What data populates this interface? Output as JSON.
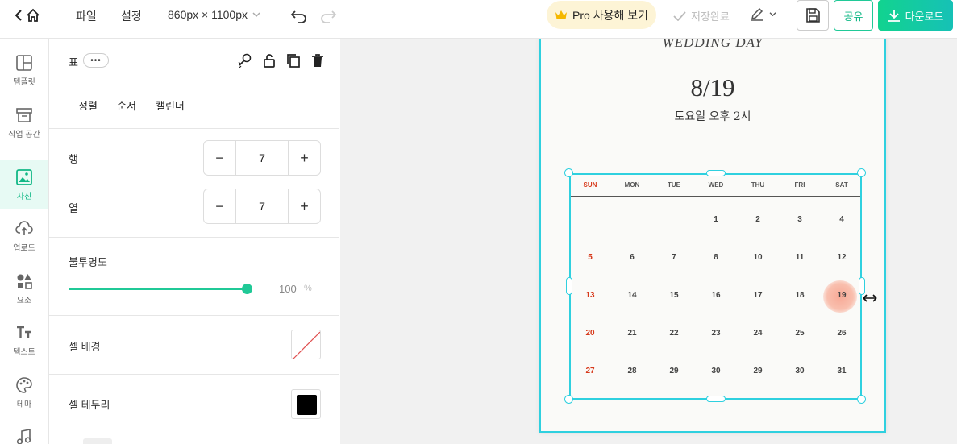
{
  "topbar": {
    "menu_file": "파일",
    "menu_settings": "설정",
    "canvas_size": "860px × 1100px",
    "pro_label": "Pro 사용해 보기",
    "save_status": "저장완료",
    "share_label": "공유",
    "download_label": "다운로드"
  },
  "rail": {
    "items": [
      {
        "label": "템플릿",
        "icon": "template-icon"
      },
      {
        "label": "작업 공간",
        "icon": "archive-icon"
      },
      {
        "label": "사진",
        "icon": "image-icon",
        "active": true
      },
      {
        "label": "업로드",
        "icon": "upload-icon"
      },
      {
        "label": "요소",
        "icon": "shapes-icon"
      },
      {
        "label": "텍스트",
        "icon": "text-icon"
      },
      {
        "label": "테마",
        "icon": "palette-icon"
      }
    ]
  },
  "panel": {
    "title": "표",
    "more": "•••",
    "tabs": [
      "정렬",
      "순서",
      "캘린더"
    ],
    "rows_label": "행",
    "rows_value": "7",
    "cols_label": "열",
    "cols_value": "7",
    "opacity_label": "불투명도",
    "opacity_value": "100",
    "opacity_unit": "%",
    "opacity_level": 1.0,
    "cell_bg_label": "셀 배경",
    "cell_border_label": "셀 테두리",
    "cell_border_color": "#000000",
    "minus": "−",
    "plus": "+"
  },
  "card": {
    "title": "WEDDING DAY",
    "date": "8/19",
    "time": "토요일 오후 2시"
  },
  "calendar": {
    "weekdays": [
      "SUN",
      "MON",
      "TUE",
      "WED",
      "THU",
      "FRI",
      "SAT"
    ],
    "weeks": [
      [
        "",
        "",
        "",
        "1",
        "2",
        "3",
        "4"
      ],
      [
        "5",
        "6",
        "7",
        "8",
        "10",
        "11",
        "12"
      ],
      [
        "13",
        "14",
        "15",
        "16",
        "17",
        "18",
        "19"
      ],
      [
        "20",
        "21",
        "22",
        "23",
        "24",
        "25",
        "26"
      ],
      [
        "27",
        "28",
        "29",
        "30",
        "29",
        "30",
        "31"
      ]
    ],
    "highlight_day": "19",
    "sunday_color": "#d7391b"
  },
  "colors": {
    "accent": "#20c997",
    "selection": "#2fd0df"
  }
}
